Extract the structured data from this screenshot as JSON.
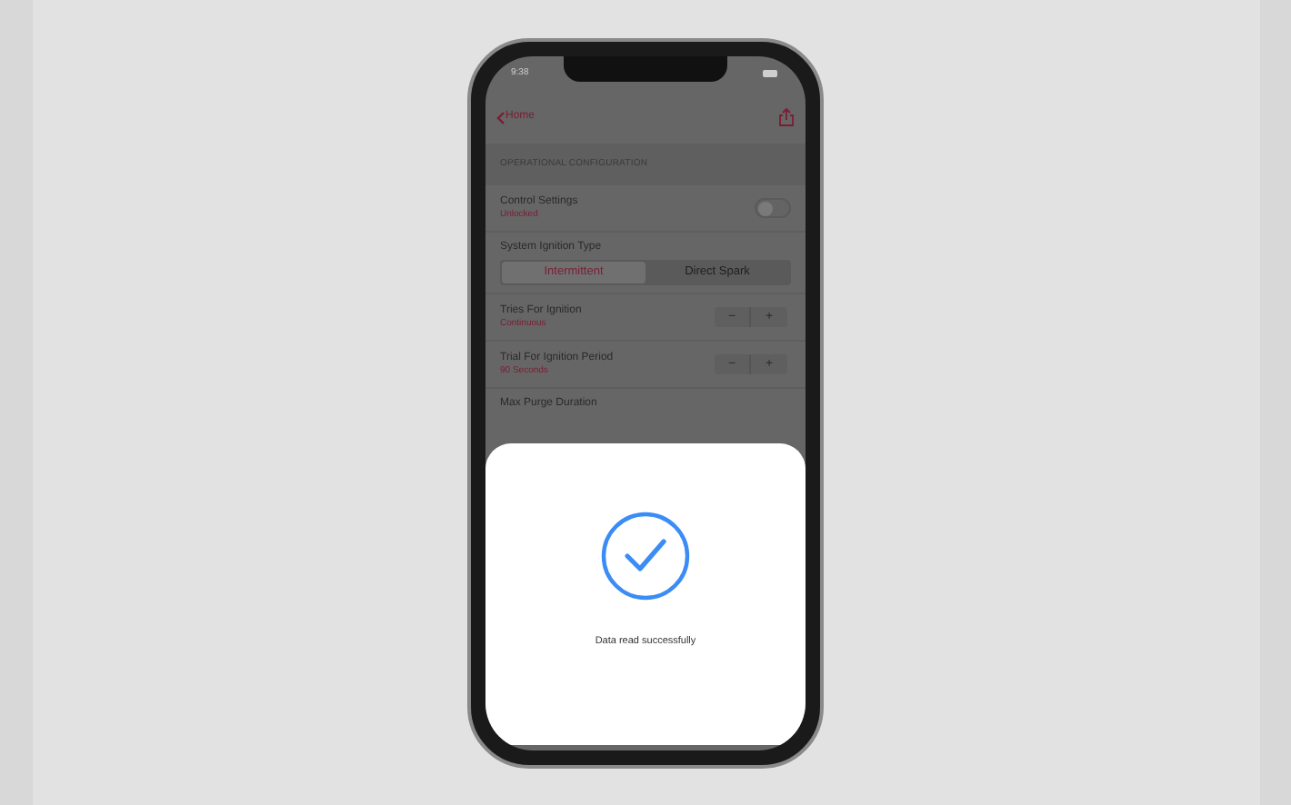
{
  "status_bar": {
    "time": "9:38"
  },
  "nav": {
    "back_label": "Home"
  },
  "section_header": "OPERATIONAL CONFIGURATION",
  "settings": [
    {
      "kind": "toggle",
      "label": "Control Settings",
      "value": "Unlocked",
      "on": false
    },
    {
      "kind": "segmented",
      "label": "System Ignition Type",
      "options": [
        {
          "label": "Intermittent",
          "selected": true
        },
        {
          "label": "Direct Spark",
          "selected": false
        }
      ]
    },
    {
      "kind": "stepper",
      "label": "Tries For Ignition",
      "value": "Continuous",
      "minus": "−",
      "plus": "+"
    },
    {
      "kind": "stepper",
      "label": "Trial For Ignition Period",
      "value": "90 Seconds",
      "minus": "−",
      "plus": "+"
    },
    {
      "kind": "plain",
      "label": "Max Purge Duration"
    }
  ],
  "sheet": {
    "message": "Data read successfully"
  }
}
